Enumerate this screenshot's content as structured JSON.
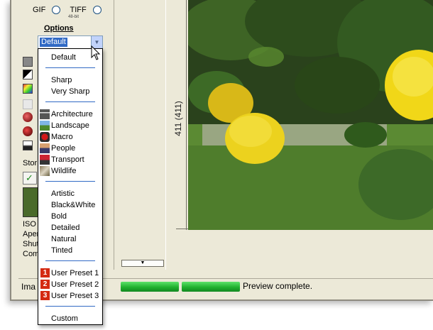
{
  "format_options": {
    "gif_label": "GIF",
    "tiff_label": "TIFF",
    "tiff_note": "48-bit"
  },
  "options": {
    "title": "Options",
    "selected": "Default"
  },
  "dropdown": {
    "items": [
      {
        "label": "Default",
        "group": 0
      },
      {
        "label": "Sharp",
        "group": 1
      },
      {
        "label": "Very Sharp",
        "group": 1
      },
      {
        "label": "Architecture",
        "group": 2,
        "icon": "architecture-icon"
      },
      {
        "label": "Landscape",
        "group": 2,
        "icon": "landscape-icon"
      },
      {
        "label": "Macro",
        "group": 2,
        "icon": "macro-icon"
      },
      {
        "label": "People",
        "group": 2,
        "icon": "people-icon"
      },
      {
        "label": "Transport",
        "group": 2,
        "icon": "transport-icon"
      },
      {
        "label": "Wildlife",
        "group": 2,
        "icon": "wildlife-icon"
      },
      {
        "label": "Artistic",
        "group": 3
      },
      {
        "label": "Black&White",
        "group": 3
      },
      {
        "label": "Bold",
        "group": 3
      },
      {
        "label": "Detailed",
        "group": 3
      },
      {
        "label": "Natural",
        "group": 3
      },
      {
        "label": "Tinted",
        "group": 3
      },
      {
        "label": "User Preset 1",
        "group": 4,
        "badge": "1"
      },
      {
        "label": "User Preset 2",
        "group": 4,
        "badge": "2"
      },
      {
        "label": "User Preset 3",
        "group": 4,
        "badge": "3"
      },
      {
        "label": "Custom",
        "group": 5
      }
    ]
  },
  "left_panel": {
    "stor_label": "Stor",
    "meta_labels": [
      "ISO",
      "Aper",
      "Shut",
      "Com"
    ]
  },
  "preview": {
    "dimension_label": "411 (411)"
  },
  "status": {
    "label": "Ima",
    "text": "Preview complete.",
    "progress": 1.0
  },
  "colors": {
    "selection": "#316ac5",
    "progress_green": "#21b02f",
    "preset_badge": "#d42a12"
  }
}
